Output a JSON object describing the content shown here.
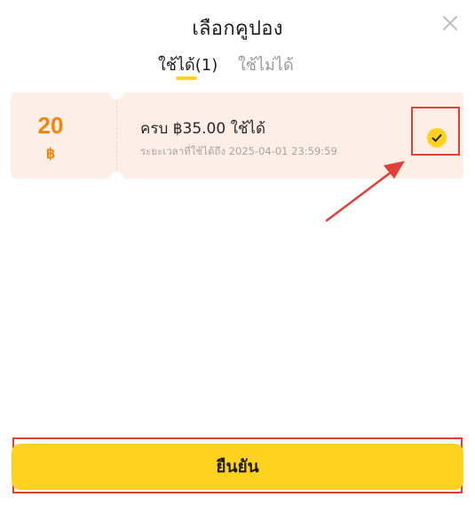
{
  "header": {
    "title": "เลือกคูปอง",
    "close_icon": "close-icon"
  },
  "tabs": {
    "available_label": "ใช้ได้(1)",
    "unavailable_label": "ใช้ไม่ได้",
    "active": "available"
  },
  "coupon": {
    "amount": "20",
    "currency": "฿",
    "condition": "ครบ ฿35.00 ใช้ได้",
    "validity": "ระยะเวลาที่ใช้ได้ถึง 2025-04-01 23:59:59",
    "selected": true,
    "check_icon": "check-icon"
  },
  "confirm": {
    "label": "ยืนยัน"
  },
  "colors": {
    "accent": "#ffd21f",
    "coupon_bg": "#fdeee6",
    "amount": "#f0860e",
    "annotation": "#e0403a"
  }
}
